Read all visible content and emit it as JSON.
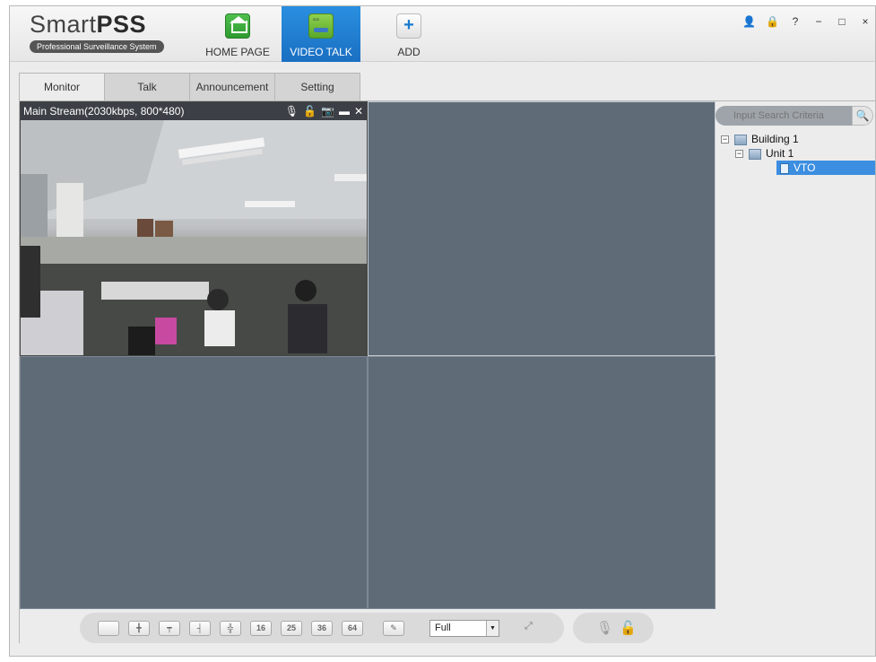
{
  "app": {
    "name_light": "Smart",
    "name_bold": "PSS",
    "subtitle": "Professional Surveillance System"
  },
  "nav": {
    "home": "HOME PAGE",
    "video_talk": "VIDEO TALK",
    "add": "ADD"
  },
  "window_controls": [
    "👤",
    "🔒",
    "?",
    "−",
    "□",
    "×"
  ],
  "tabs": [
    "Monitor",
    "Talk",
    "Announcement",
    "Setting"
  ],
  "active_tab": "Monitor",
  "video": {
    "stream_label": "Main Stream(2030kbps, 800*480)",
    "icons": [
      "microphone-icon",
      "unlock-icon",
      "snapshot-icon",
      "record-icon",
      "close-icon"
    ]
  },
  "toolbar": {
    "layouts": [
      "1",
      "4",
      "6",
      "8",
      "9",
      "16",
      "25",
      "36",
      "64"
    ],
    "custom_layout_icon": "edit-layout-icon",
    "aspect_value": "Full",
    "fullscreen_icon": "fullscreen-icon",
    "talk_icons": [
      "microphone-icon",
      "unlock-icon"
    ]
  },
  "search": {
    "placeholder": "Input Search Criteria"
  },
  "tree": {
    "building": "Building 1",
    "unit": "Unit 1",
    "device": "VTO"
  }
}
